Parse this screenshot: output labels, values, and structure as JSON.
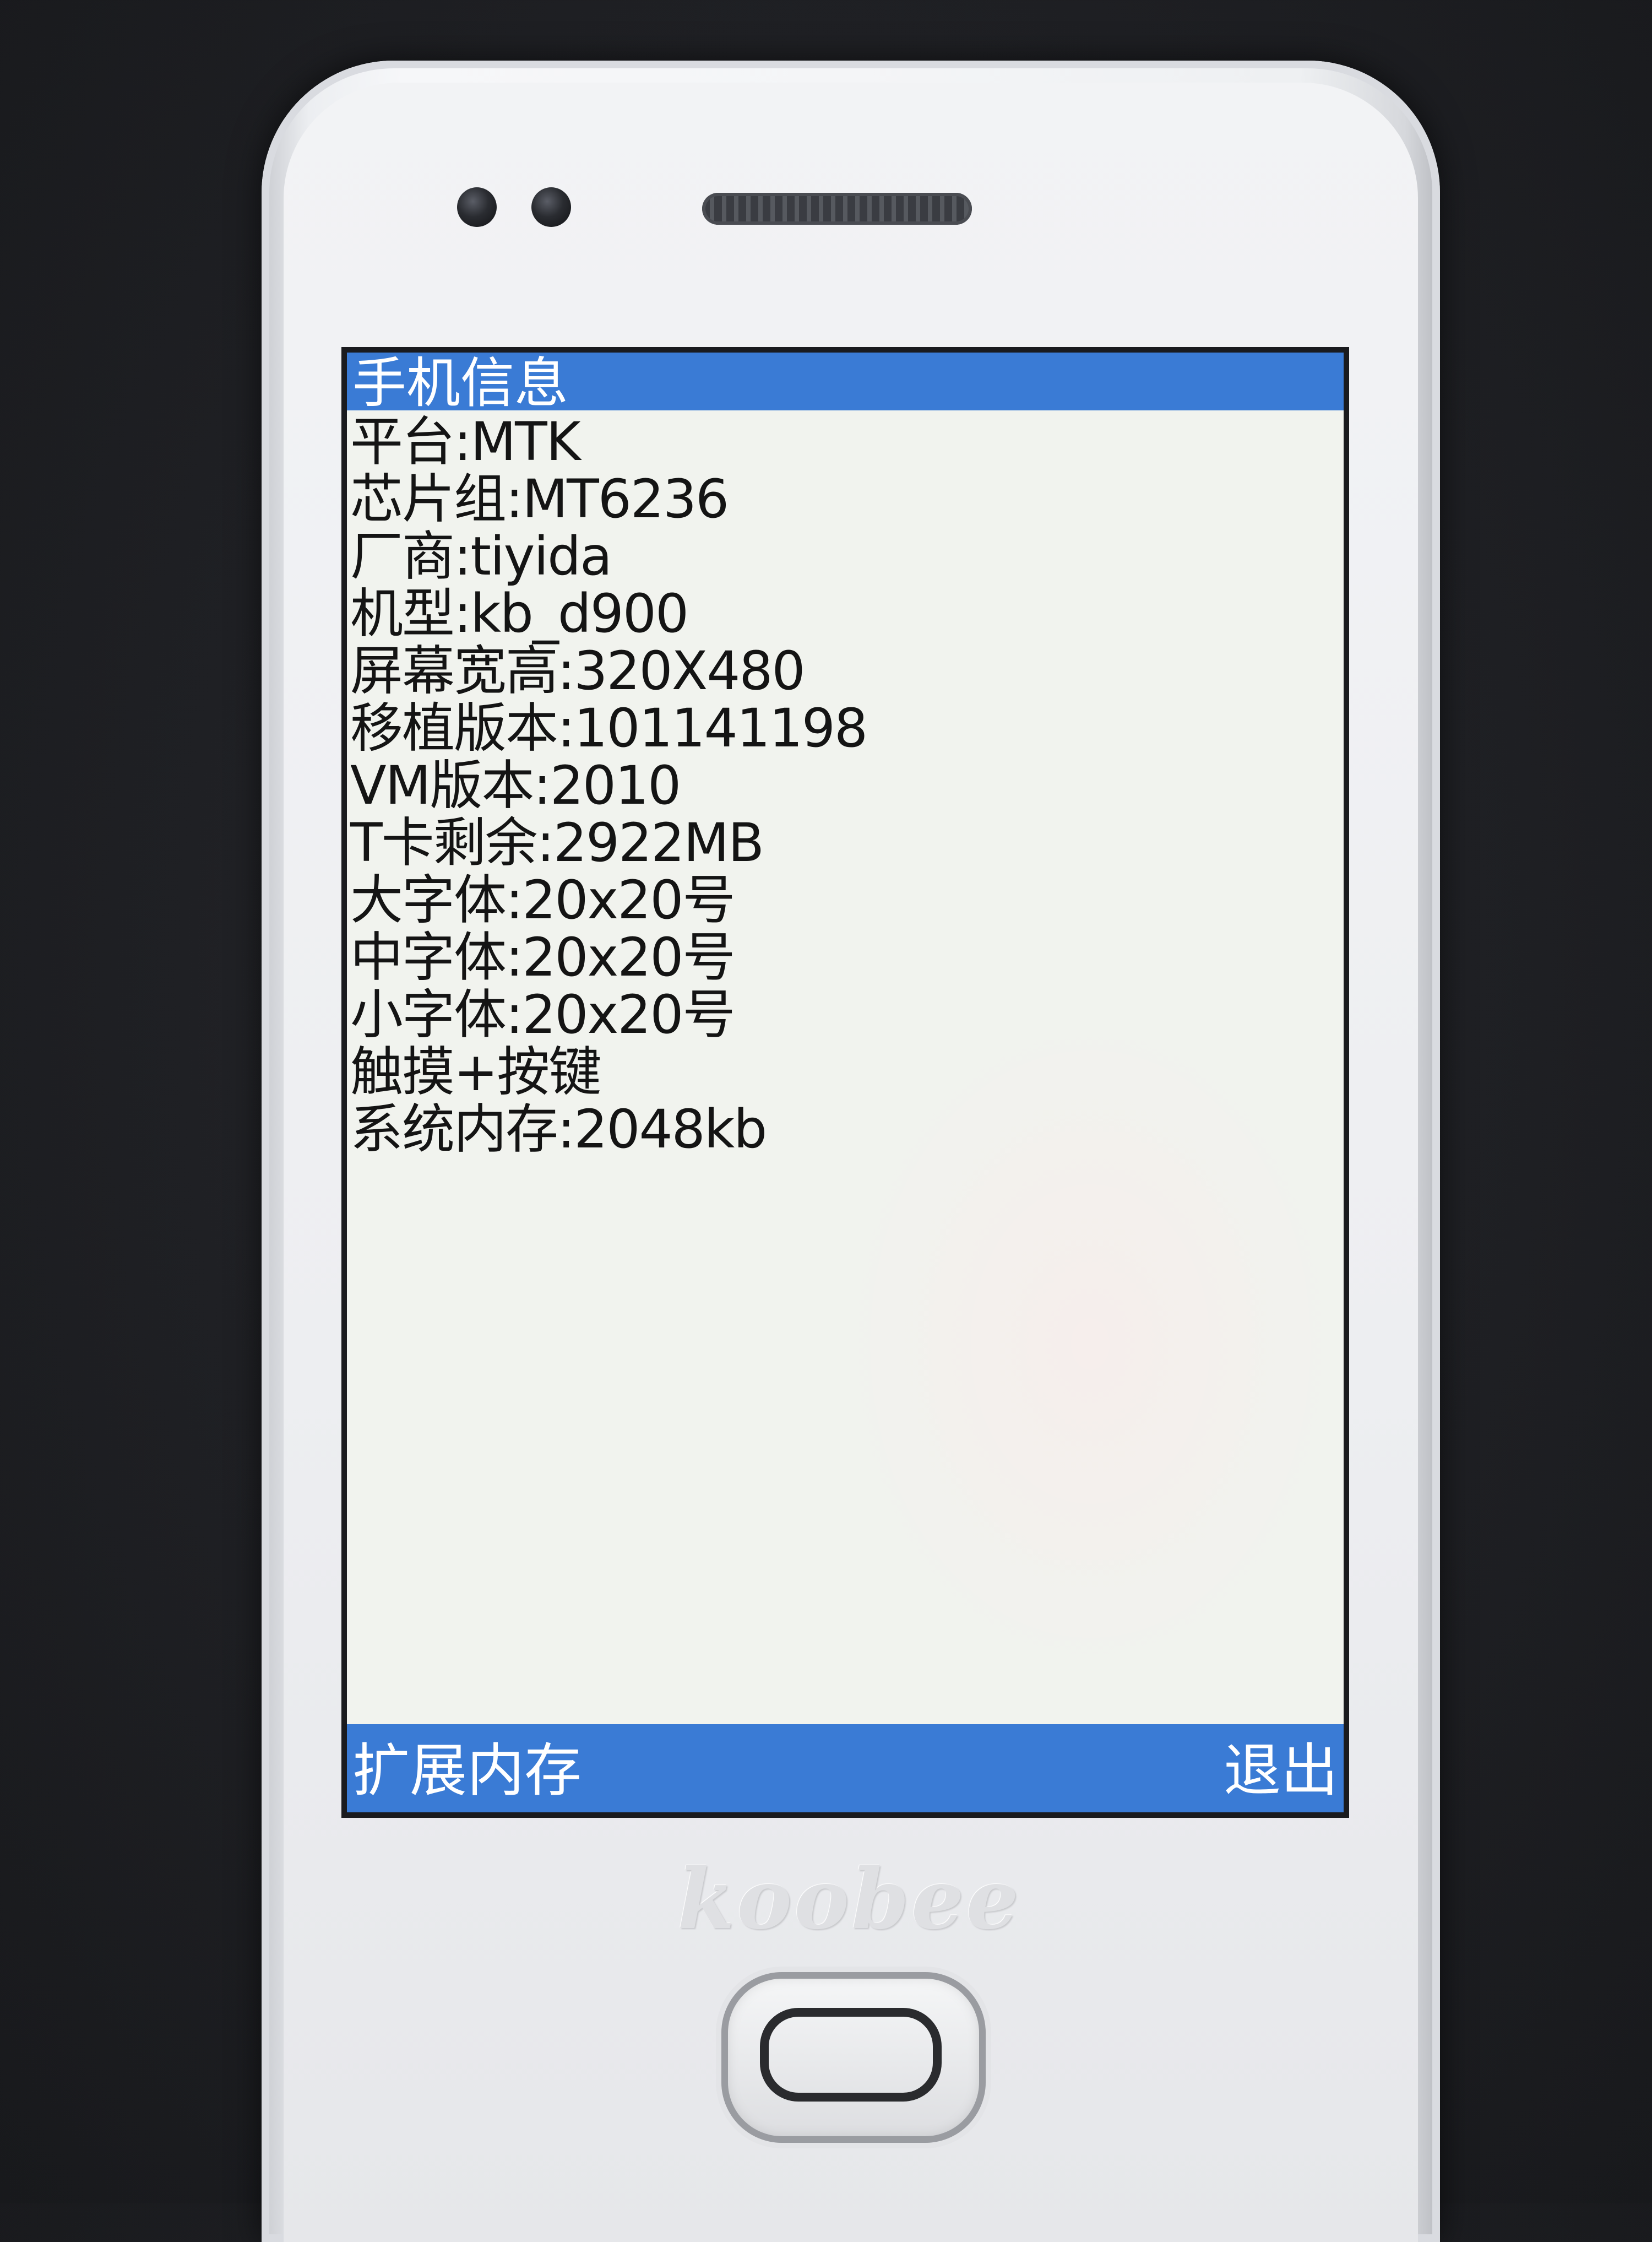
{
  "screen": {
    "title": "手机信息",
    "info_lines": [
      "平台:MTK",
      "芯片组:MT6236",
      "厂商:tiyida",
      "机型:kb_d900",
      "屏幕宽高:320X480",
      "移植版本:101141198",
      "VM版本:2010",
      "T卡剩余:2922MB",
      "大字体:20x20号",
      "中字体:20x20号",
      "小字体:20x20号",
      "触摸+按键",
      "系统内存:2048kb"
    ],
    "softkey_left": "扩展内存",
    "softkey_right": "退出"
  },
  "device": {
    "brand": "koobee"
  },
  "colors": {
    "bar_blue": "#3a7bd5",
    "screen_bg": "#f1f3ee",
    "text": "#141414"
  }
}
